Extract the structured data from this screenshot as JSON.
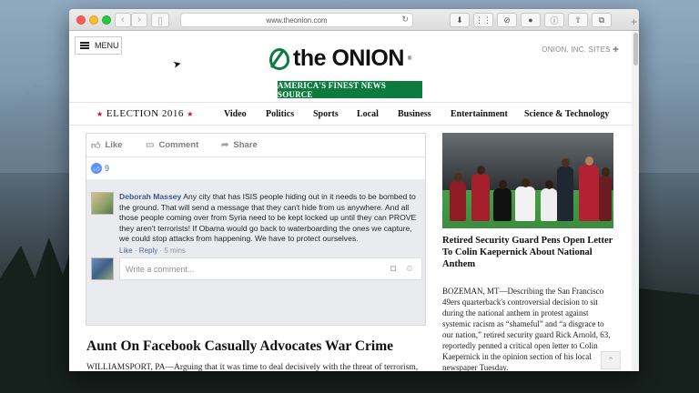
{
  "browser": {
    "url": "www.theonion.com"
  },
  "site": {
    "menu_label": "MENU",
    "sites_label": "ONION, INC. SITES ✚",
    "logo_text": "the ONION",
    "logo_reg": "®",
    "tagline": "AMERICA'S FINEST NEWS SOURCE",
    "brand_color": "#0c7b3e"
  },
  "nav": {
    "election": "ELECTION 2016",
    "items": [
      "Video",
      "Politics",
      "Sports",
      "Local",
      "Business",
      "Entertainment",
      "Science & Technology"
    ]
  },
  "facebook": {
    "actions": [
      "Like",
      "Comment",
      "Share"
    ],
    "like_count": "9",
    "comment": {
      "author": "Deborah Massey",
      "text": "Any city that has ISIS people hiding out in it needs to be bombed to the ground. That will send a message that they can't hide from us anywhere. And all those people coming over from Syria need to be kept locked up until they can PROVE they aren't terrorists! If Obama would go back to waterboarding the ones we capture, we could stop attacks from happening. We have to protect ourselves.",
      "like": "Like",
      "reply": "Reply",
      "time": "5 mins"
    },
    "write_placeholder": "Write a comment..."
  },
  "main_article": {
    "headline": "Aunt On Facebook Casually Advocates War Crime",
    "body": "WILLIAMSPORT, PA—Arguing that it was time to deal decisively with the threat of terrorism, local aunt Deborah Massey casually advocated a war crime Monday in a brief Facebook post."
  },
  "side_article": {
    "headline": "Retired Security Guard Pens Open Letter To Colin Kaepernick About National Anthem",
    "body": "BOZEMAN, MT—Describing the San Francisco 49ers quarterback's controversial decision to sit during the national anthem in protest against systemic racism as “shameful” and “a disgrace to our nation,” retired security guard Rick Arnold, 63, reportedly penned a critical open letter to Colin Kaepernick in the opinion section of his local newspaper Tuesday."
  }
}
